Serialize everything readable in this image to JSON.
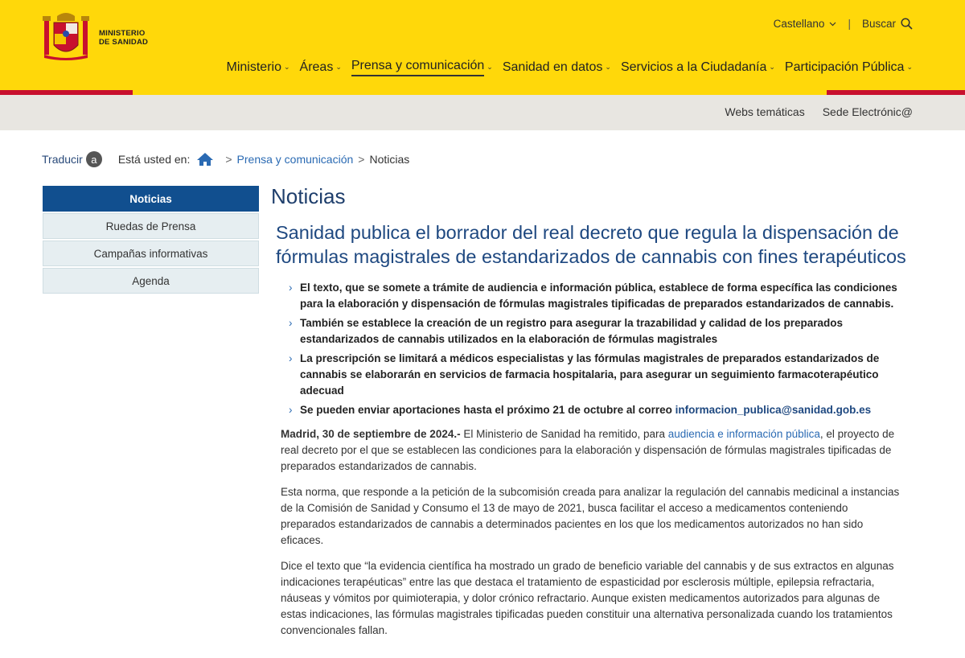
{
  "header": {
    "logo_line1": "MINISTERIO",
    "logo_line2": "DE SANIDAD",
    "language": "Castellano",
    "search_label": "Buscar",
    "nav": [
      {
        "label": "Ministerio",
        "active": false
      },
      {
        "label": "Áreas",
        "active": false
      },
      {
        "label": "Prensa y comunicación",
        "active": true
      },
      {
        "label": "Sanidad en datos",
        "active": false
      },
      {
        "label": "Servicios a la Ciudadanía",
        "active": false
      },
      {
        "label": "Participación Pública",
        "active": false
      }
    ],
    "sublinks": [
      "Webs temáticas",
      "Sede Electrónic@"
    ]
  },
  "breadcrumb": {
    "translate_label": "Traducir",
    "translate_badge": "a",
    "here_label": "Está usted en:",
    "items": [
      "Prensa y comunicación",
      "Noticias"
    ]
  },
  "sidebar": {
    "items": [
      {
        "label": "Noticias",
        "active": true
      },
      {
        "label": "Ruedas de Prensa",
        "active": false
      },
      {
        "label": "Campañas informativas",
        "active": false
      },
      {
        "label": "Agenda",
        "active": false
      }
    ]
  },
  "main": {
    "page_title": "Noticias",
    "headline": "Sanidad publica el borrador del real decreto que regula la dispensación de fórmulas magistrales de estandarizados de cannabis con fines terapéuticos",
    "bullets": [
      "El texto, que se somete a trámite de audiencia e información pública, establece de forma específica las condiciones para la elaboración y dispensación de fórmulas magistrales tipificadas de preparados estandarizados de cannabis.",
      "También se establece la creación de un registro para asegurar la trazabilidad y calidad de los preparados estandarizados de cannabis utilizados en la elaboración de fórmulas magistrales",
      "La prescripción se limitará a médicos especialistas y las fórmulas magistrales de preparados estandarizados de cannabis se elaborarán en servicios de farmacia hospitalaria, para asegurar un seguimiento farmacoterapéutico adecuad"
    ],
    "bullet4_text": "Se pueden enviar aportaciones hasta el próximo 21 de octubre  al correo",
    "bullet4_email": "informacion_publica@sanidad.gob.es",
    "p1_date": "Madrid, 30 de septiembre de 2024.-",
    "p1_before": " El Ministerio de Sanidad ha remitido, para ",
    "p1_link": "audiencia e información pública",
    "p1_after": ", el proyecto de real decreto por el que se establecen las condiciones para la elaboración y dispensación de fórmulas magistrales tipificadas de preparados estandarizados de cannabis.",
    "p2": "Esta norma, que responde a la petición de la subcomisión creada para analizar la regulación del cannabis medicinal a instancias de la Comisión de Sanidad y Consumo el 13 de mayo de 2021, busca facilitar el acceso a medicamentos conteniendo preparados estandarizados de cannabis a determinados pacientes en los que los medicamentos autorizados no han sido eficaces.",
    "p3": "Dice el texto que “la evidencia científica ha mostrado un grado de beneficio variable del cannabis y de sus extractos en algunas indicaciones terapéuticas” entre las que destaca el tratamiento de espasticidad por esclerosis múltiple, epilepsia refractaria, náuseas y vómitos por quimioterapia, y dolor crónico refractario. Aunque existen medicamentos autorizados para algunas de estas indicaciones, las fórmulas magistrales tipificadas pueden constituir una alternativa personalizada cuando los tratamientos convencionales fallan."
  }
}
